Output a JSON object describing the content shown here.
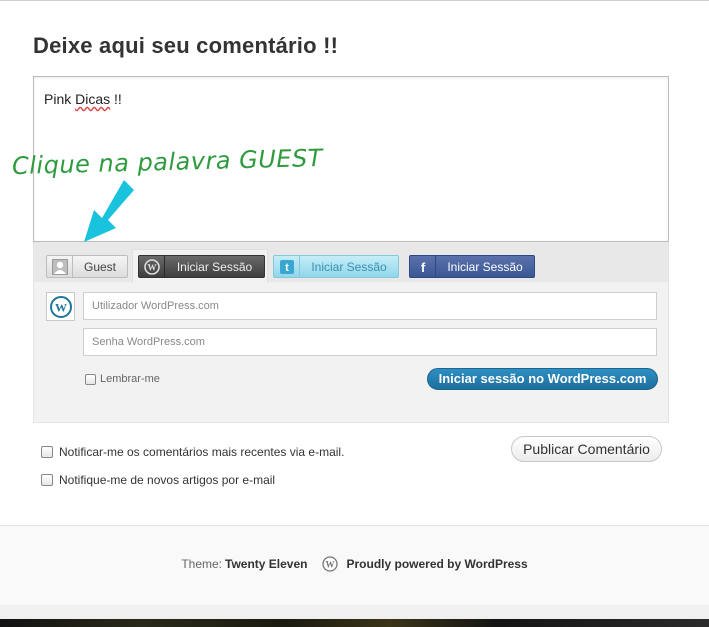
{
  "heading": "Deixe aqui seu comentário !!",
  "comment": {
    "text_prefix": "Pink ",
    "text_misspelled": "Dicas",
    "text_suffix": " !!"
  },
  "annotation": {
    "text": "Clique na palavra GUEST",
    "color": "#2e9b3f",
    "arrow_color": "#19c3dd"
  },
  "tabs": [
    {
      "id": "guest",
      "label": "Guest",
      "icon": "user-icon"
    },
    {
      "id": "wordpress",
      "label": "Iniciar Sessão",
      "icon": "wordpress-icon"
    },
    {
      "id": "twitter",
      "label": "Iniciar Sessão",
      "icon": "twitter-icon"
    },
    {
      "id": "facebook",
      "label": "Iniciar Sessão",
      "icon": "facebook-icon"
    }
  ],
  "login": {
    "username_placeholder": "Utilizador WordPress.com",
    "password_placeholder": "Senha WordPress.com",
    "remember_label": "Lembrar-me",
    "submit_label": "Iniciar sessão no WordPress.com",
    "submit_color": "#1d6e9c"
  },
  "options": {
    "notify_comments": "Notificar-me os comentários mais recentes via e-mail.",
    "notify_posts": "Notifique-me de novos artigos por e-mail"
  },
  "publish_label": "Publicar Comentário",
  "footer": {
    "theme_prefix": "Theme: ",
    "theme_name": "Twenty Eleven",
    "powered": "Proudly powered by WordPress"
  }
}
